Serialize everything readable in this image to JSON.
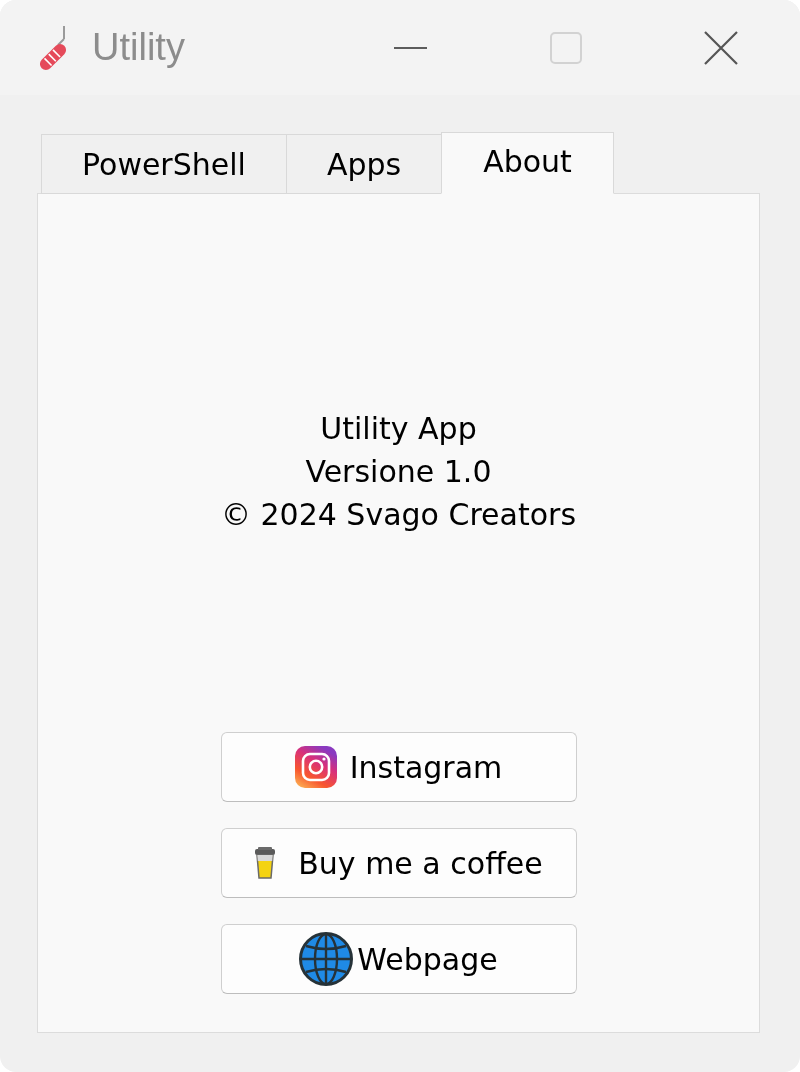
{
  "window": {
    "title": "Utility"
  },
  "tabs": [
    {
      "label": "PowerShell",
      "selected": false
    },
    {
      "label": "Apps",
      "selected": false
    },
    {
      "label": "About",
      "selected": true
    }
  ],
  "about": {
    "lines": [
      "Utility App",
      "Versione 1.0",
      "© 2024 Svago Creators"
    ]
  },
  "buttons": [
    {
      "label": "Instagram",
      "kind": "instagram"
    },
    {
      "label": "Buy me a coffee",
      "kind": "coffee"
    },
    {
      "label": "Webpage",
      "kind": "web"
    }
  ]
}
